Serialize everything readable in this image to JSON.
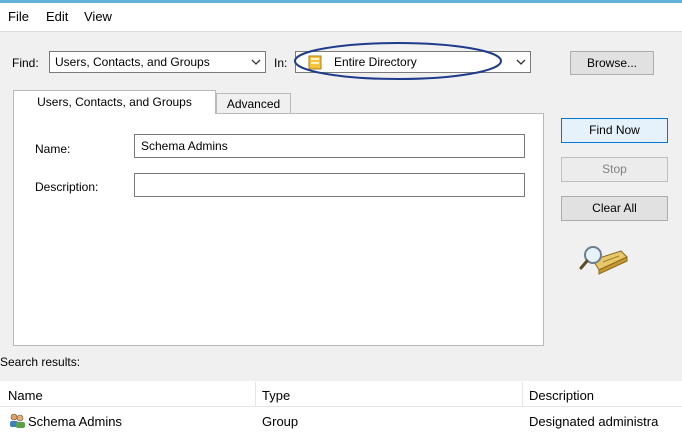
{
  "menu": {
    "file": "File",
    "edit": "Edit",
    "view": "View"
  },
  "find": {
    "label": "Find:",
    "value": "Users, Contacts, and Groups",
    "in_label": "In:",
    "in_value": "Entire Directory",
    "browse_button": "Browse..."
  },
  "tabs": [
    "Users, Contacts, and Groups",
    "Advanced"
  ],
  "form": {
    "name_label": "Name:",
    "name_value": "Schema Admins",
    "description_label": "Description:",
    "description_value": ""
  },
  "buttons": {
    "find_now": "Find Now",
    "stop": "Stop",
    "clear_all": "Clear All"
  },
  "results": {
    "label": "Search results:",
    "columns": [
      "Name",
      "Type",
      "Description"
    ],
    "rows": [
      {
        "name": "Schema Admins",
        "type": "Group",
        "description": "Designated administra"
      }
    ]
  },
  "colors": {
    "accent": "#0078d7",
    "highlight_ellipse": "#1f3c8c",
    "title_strip": "#63b3dd"
  },
  "icons": [
    "directory-icon",
    "search-magnifier-icon",
    "group-icon",
    "chevron-down-icon"
  ]
}
